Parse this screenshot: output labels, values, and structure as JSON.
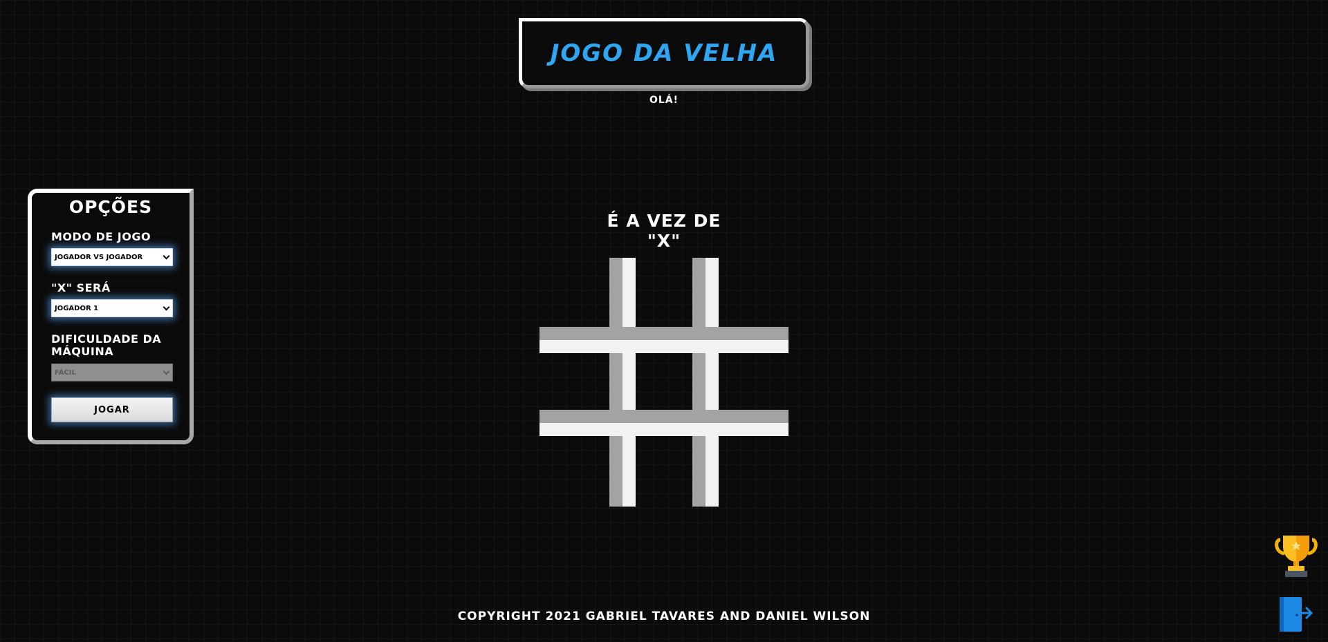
{
  "header": {
    "title": "Jogo da Velha",
    "greeting": "Olá!"
  },
  "options": {
    "title": "Opções",
    "mode_label": "Modo de Jogo",
    "mode_value": "Jogador vs Jogador",
    "x_label": "\"X\" será",
    "x_value": "Jogador 1",
    "difficulty_label": "Dificuldade da Máquina",
    "difficulty_value": "Fácil",
    "play_label": "Jogar"
  },
  "game": {
    "turn_line1": "É a vez de",
    "turn_line2": "\"X\"",
    "cells": [
      "",
      "",
      "",
      "",
      "",
      "",
      "",
      "",
      ""
    ]
  },
  "footer": {
    "copyright": "Copyright 2021 Gabriel Tavares and Daniel Wilson"
  },
  "icons": {
    "trophy": "trophy-icon",
    "exit": "exit-door-icon"
  },
  "colors": {
    "title": "#2fa6f2",
    "background": "#0b0b0b",
    "glow": "#5aaaff"
  }
}
